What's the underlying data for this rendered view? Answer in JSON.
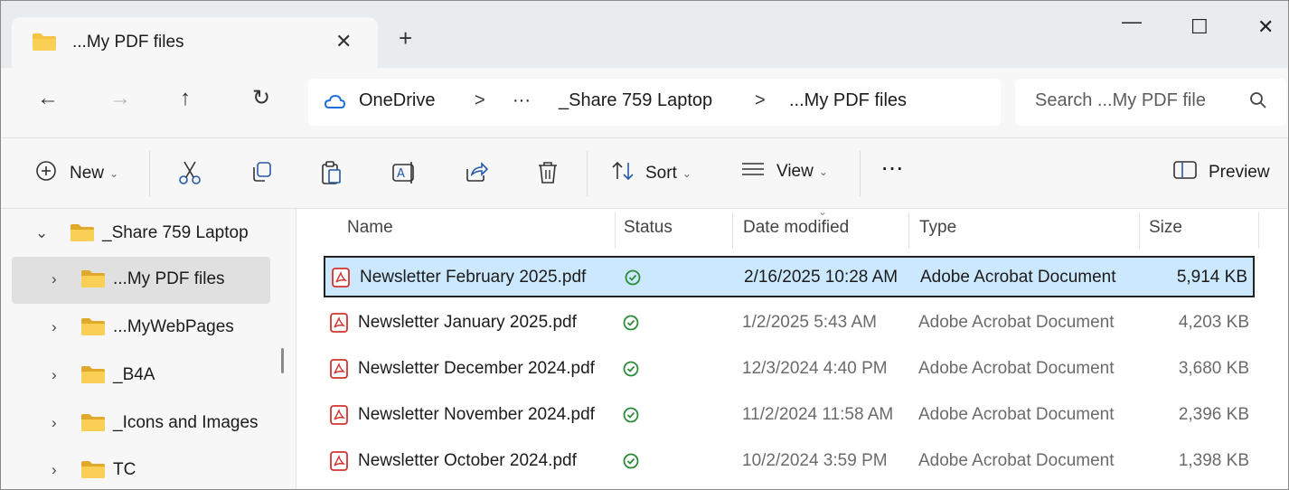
{
  "tab": {
    "title": "...My PDF files",
    "close": "✕",
    "new_tab": "+"
  },
  "window_controls": {
    "minimize": "—",
    "maximize": "☐",
    "close": "✕"
  },
  "nav_buttons": {
    "back": "←",
    "forward": "→",
    "up": "↑",
    "refresh": "↻"
  },
  "address": {
    "segments": [
      "OneDrive",
      "···",
      "_Share 759 Laptop",
      "...My PDF files"
    ],
    "separator": ">"
  },
  "search": {
    "placeholder": "Search ...My PDF file"
  },
  "toolbar": {
    "new_label": "New",
    "sort_label": "Sort",
    "view_label": "View",
    "more_label": "···",
    "preview_label": "Preview",
    "actions": [
      "cut",
      "copy",
      "paste",
      "rename",
      "share",
      "delete"
    ]
  },
  "sidebar": {
    "items": [
      {
        "label": "_Share 759 Laptop",
        "expanded": true,
        "indent": 0,
        "selected": false
      },
      {
        "label": "...My PDF files",
        "expanded": false,
        "indent": 1,
        "selected": true
      },
      {
        "label": "...MyWebPages",
        "expanded": false,
        "indent": 1,
        "selected": false
      },
      {
        "label": "_B4A",
        "expanded": false,
        "indent": 1,
        "selected": false
      },
      {
        "label": "_Icons and Images",
        "expanded": false,
        "indent": 1,
        "selected": false
      },
      {
        "label": "TC",
        "expanded": false,
        "indent": 1,
        "selected": false
      }
    ]
  },
  "files": {
    "columns": [
      "Name",
      "Status",
      "Date modified",
      "Type",
      "Size"
    ],
    "rows": [
      {
        "name": "Newsletter February 2025.pdf",
        "date": "2/16/2025 10:28 AM",
        "type": "Adobe Acrobat Document",
        "size": "5,914 KB",
        "selected": true
      },
      {
        "name": "Newsletter January 2025.pdf",
        "date": "1/2/2025 5:43 AM",
        "type": "Adobe Acrobat Document",
        "size": "4,203 KB",
        "selected": false
      },
      {
        "name": "Newsletter December 2024.pdf",
        "date": "12/3/2024 4:40 PM",
        "type": "Adobe Acrobat Document",
        "size": "3,680 KB",
        "selected": false
      },
      {
        "name": "Newsletter November 2024.pdf",
        "date": "11/2/2024 11:58 AM",
        "type": "Adobe Acrobat Document",
        "size": "2,396 KB",
        "selected": false
      },
      {
        "name": "Newsletter October 2024.pdf",
        "date": "10/2/2024 3:59 PM",
        "type": "Adobe Acrobat Document",
        "size": "1,398 KB",
        "selected": false
      }
    ]
  },
  "colors": {
    "folder": "#f5c445",
    "folder_dark": "#e0a92b",
    "pdf_red": "#d1332e",
    "status_green": "#2e8b3a",
    "selection_bg": "#cce8ff",
    "onedrive_blue": "#1e6fd9"
  }
}
